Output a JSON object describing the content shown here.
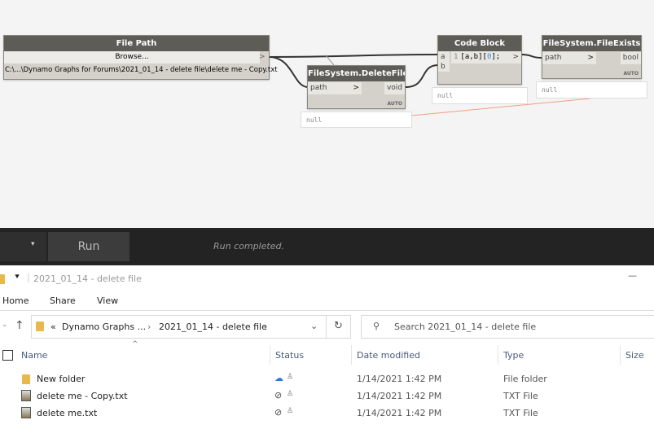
{
  "canvas": {
    "file_path": {
      "title": "File Path",
      "browse": "Browse...",
      "out": ">",
      "path": "C:\\...\\Dynamo Graphs for Forums\\2021_01_14 - delete file\\delete me - Copy.txt"
    },
    "delete_file": {
      "title": "FileSystem.DeleteFile",
      "in": "path",
      "arrow": ">",
      "out": "void",
      "lacing": "AUTO",
      "watch": "null"
    },
    "code_block": {
      "title": "Code Block",
      "in_a": "a",
      "in_b": "b",
      "line": "1",
      "code_pre": "[a,b][",
      "code_idx": "0",
      "code_post": "];",
      "out": ">",
      "watch": "null"
    },
    "file_exists": {
      "title": "FileSystem.FileExists",
      "in": "path",
      "arrow": ">",
      "out": "bool",
      "lacing": "AUTO",
      "watch": "null"
    }
  },
  "runbar": {
    "run_label": "Run",
    "dropdown_arrow": "▾",
    "status": "Run completed."
  },
  "explorer": {
    "title": "2021_01_14 - delete file",
    "ribbon": [
      "Home",
      "Share",
      "View"
    ],
    "breadcrumb": {
      "prefix": "«",
      "parts": [
        "Dynamo Graphs ...",
        "2021_01_14 - delete file"
      ]
    },
    "search_placeholder": "Search 2021_01_14 - delete file",
    "columns": [
      "Name",
      "Status",
      "Date modified",
      "Type",
      "Size"
    ],
    "rows": [
      {
        "name": "New folder",
        "date": "1/14/2021 1:42 PM",
        "type": "File folder",
        "status": "cloud"
      },
      {
        "name": "delete me - Copy.txt",
        "date": "1/14/2021 1:42 PM",
        "type": "TXT File",
        "status": "synced"
      },
      {
        "name": "delete me.txt",
        "date": "1/14/2021 1:42 PM",
        "type": "TXT File",
        "status": "synced"
      }
    ]
  }
}
